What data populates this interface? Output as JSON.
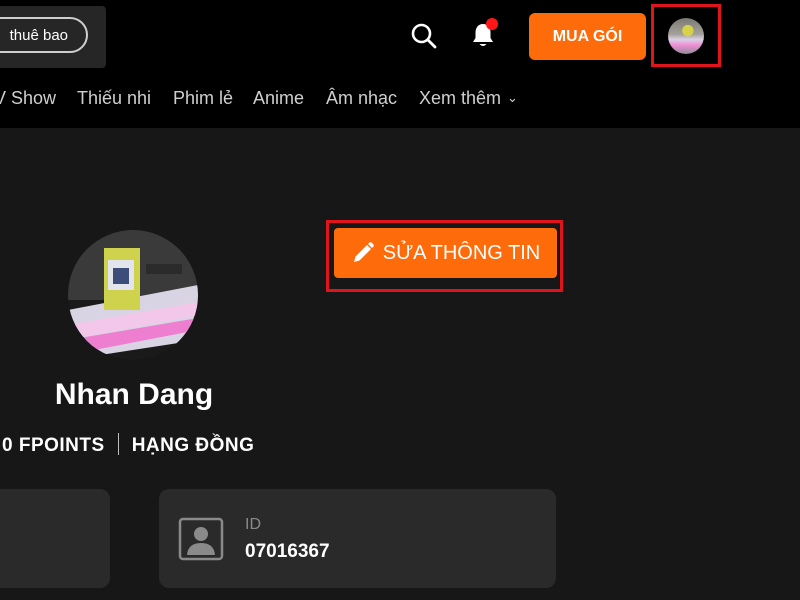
{
  "header": {
    "subscription_label": "thuê bao",
    "buy_button": "MUA GÓI",
    "notification_dot_color": "#ff1717",
    "accent": "#fe6b0a"
  },
  "nav": {
    "items": [
      "V Show",
      "Thiếu nhi",
      "Phim lẻ",
      "Anime",
      "Âm nhạc",
      "Xem thêm"
    ]
  },
  "profile": {
    "name": "Nhan Dang",
    "points": "0 FPOINTS",
    "rank": "HẠNG ĐỒNG",
    "edit_button": "SỬA THÔNG TIN",
    "id_label": "ID",
    "id_value": "07016367"
  },
  "icons": [
    "search-icon",
    "bell-icon",
    "pencil-icon",
    "id-card-icon",
    "chevron-down-icon"
  ]
}
